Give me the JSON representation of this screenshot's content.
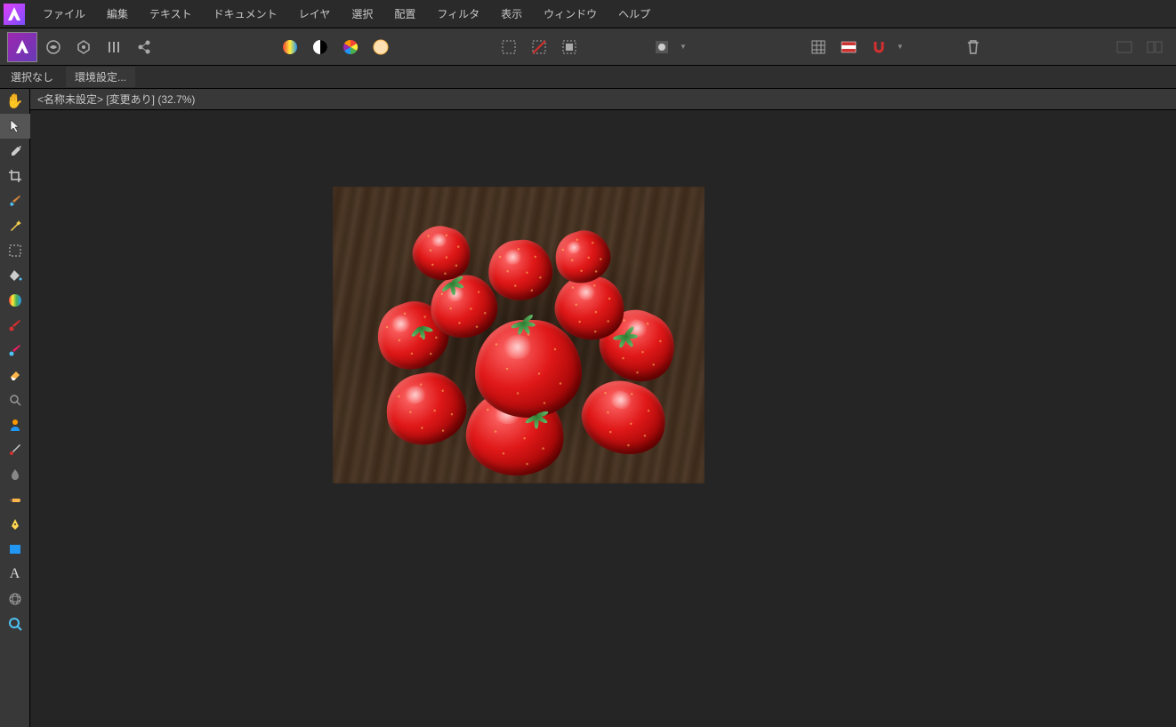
{
  "menu": [
    "ファイル",
    "編集",
    "テキスト",
    "ドキュメント",
    "レイヤ",
    "選択",
    "配置",
    "フィルタ",
    "表示",
    "ウィンドウ",
    "ヘルプ"
  ],
  "context": {
    "selection": "選択なし",
    "prefs": "環境設定..."
  },
  "document": {
    "tab": "<名称未設定> [変更あり] (32.7%)"
  },
  "personas": [
    "photo-persona",
    "liquify-persona",
    "develop-persona",
    "tone-map-persona",
    "export-persona"
  ],
  "toolbar_groups": {
    "adjust": [
      "auto-levels-icon",
      "auto-contrast-icon",
      "auto-colors-icon",
      "auto-wb-icon"
    ],
    "select_ops": [
      "marquee-select-icon",
      "deselect-icon",
      "invert-select-icon"
    ],
    "quick_mask": [
      "quick-mask-icon"
    ],
    "snap": [
      "grid-icon",
      "guides-icon",
      "snap-icon"
    ],
    "trash": [
      "trash-icon"
    ]
  },
  "side_tools": [
    "hand-tool",
    "move-tool",
    "color-picker-tool",
    "crop-tool",
    "brush-tool",
    "magic-wand-tool",
    "marquee-tool",
    "flood-fill-tool",
    "gradient-tool",
    "paint-brush-tool",
    "eraser-tool",
    "pencil-tool",
    "zoom-detail-tool",
    "portrait-tool",
    "redeye-tool",
    "blur-tool",
    "dodge-tool",
    "pen-tool",
    "rectangle-tool",
    "text-tool",
    "mesh-tool",
    "zoom-tool"
  ]
}
